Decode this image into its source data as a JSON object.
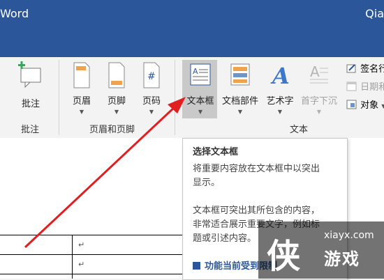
{
  "titlebar": {
    "app": "Word",
    "user": "Qia"
  },
  "ribbon": {
    "comment": {
      "label": "批注",
      "group": "批注",
      "icon": "comment-add-icon"
    },
    "header_footer": {
      "group": "页眉和页脚",
      "buttons": [
        {
          "label": "页眉",
          "icon": "header-icon"
        },
        {
          "label": "页脚",
          "icon": "footer-icon"
        },
        {
          "label": "页码",
          "icon": "page-number-icon"
        }
      ]
    },
    "text": {
      "group": "文本",
      "buttons": [
        {
          "label": "文本框",
          "icon": "text-box-icon"
        },
        {
          "label": "文档部件",
          "icon": "quick-parts-icon"
        },
        {
          "label": "艺术字",
          "icon": "wordart-icon"
        },
        {
          "label": "首字下沉",
          "icon": "drop-cap-icon"
        }
      ],
      "small": [
        {
          "label": "签名行",
          "icon": "signature-line-icon"
        },
        {
          "label": "日期和",
          "icon": "date-time-icon"
        },
        {
          "label": "对象",
          "icon": "object-icon"
        }
      ]
    }
  },
  "tooltip": {
    "title": "选择文本框",
    "line1": "将重要内容放在文本框中以突出",
    "line2": "显示。",
    "line3": "文本框可突出其所包含的内容，",
    "line4": "非常适合展示重要文字，例如标",
    "line5": "题或引述内容。",
    "more": "功能当前受到限制。"
  },
  "document": {
    "para_mark": "↵"
  },
  "watermark": {
    "big": "侠",
    "site": "xiayx.com",
    "name": "游戏"
  },
  "colors": {
    "titlebar": "#2b579a",
    "arrow": "#e02020",
    "ribbon": "#f3f3f3"
  }
}
